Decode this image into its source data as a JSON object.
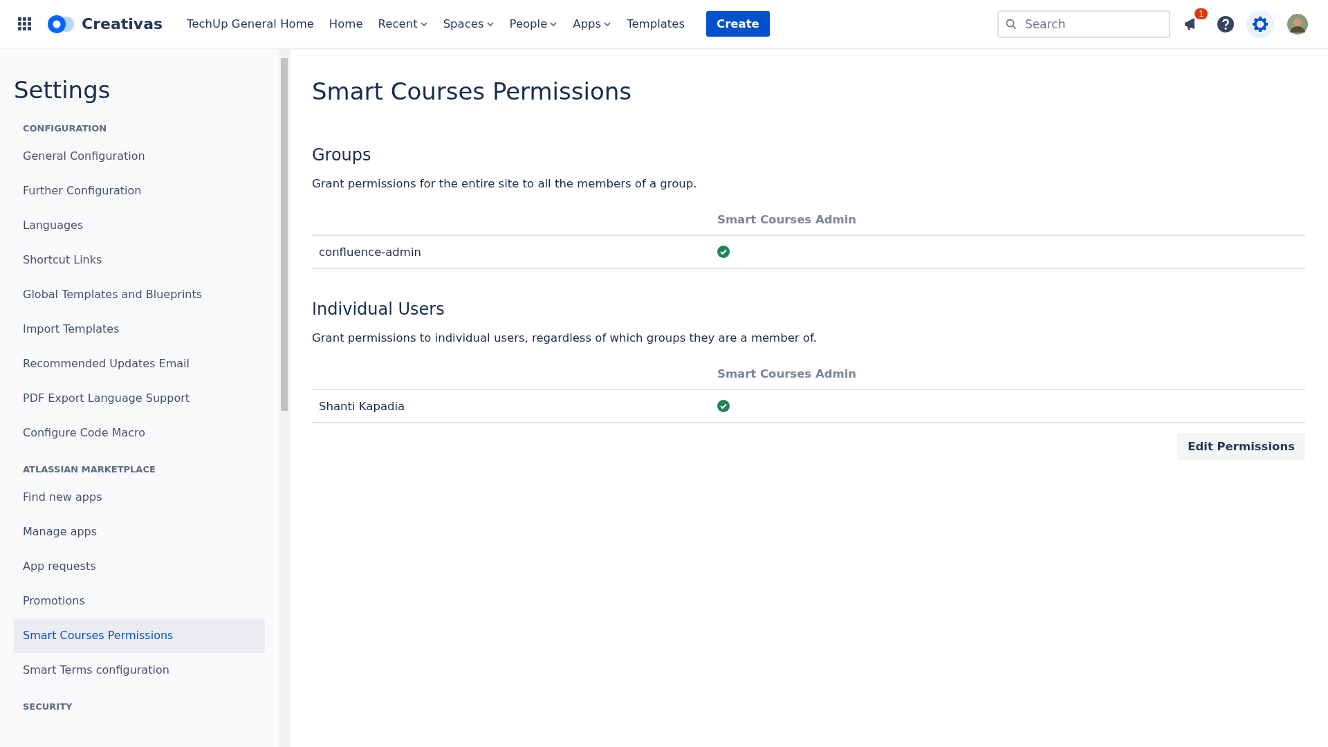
{
  "header": {
    "logo": "Creativas",
    "nav": [
      {
        "label": "TechUp General Home",
        "dropdown": false
      },
      {
        "label": "Home",
        "dropdown": false
      },
      {
        "label": "Recent",
        "dropdown": true
      },
      {
        "label": "Spaces",
        "dropdown": true
      },
      {
        "label": "People",
        "dropdown": true
      },
      {
        "label": "Apps",
        "dropdown": true
      },
      {
        "label": "Templates",
        "dropdown": false
      }
    ],
    "create": "Create",
    "search": {
      "placeholder": "Search"
    },
    "notification_count": "1"
  },
  "sidebar": {
    "title": "Settings",
    "sections": [
      {
        "heading": "CONFIGURATION",
        "items": [
          {
            "label": "General Configuration",
            "selected": false
          },
          {
            "label": "Further Configuration",
            "selected": false
          },
          {
            "label": "Languages",
            "selected": false
          },
          {
            "label": "Shortcut Links",
            "selected": false
          },
          {
            "label": "Global Templates and Blueprints",
            "selected": false
          },
          {
            "label": "Import Templates",
            "selected": false
          },
          {
            "label": "Recommended Updates Email",
            "selected": false
          },
          {
            "label": "PDF Export Language Support",
            "selected": false
          },
          {
            "label": "Configure Code Macro",
            "selected": false
          }
        ]
      },
      {
        "heading": "ATLASSIAN MARKETPLACE",
        "items": [
          {
            "label": "Find new apps",
            "selected": false
          },
          {
            "label": "Manage apps",
            "selected": false
          },
          {
            "label": "App requests",
            "selected": false
          },
          {
            "label": "Promotions",
            "selected": false
          },
          {
            "label": "Smart Courses Permissions",
            "selected": true
          },
          {
            "label": "Smart Terms configuration",
            "selected": false
          }
        ]
      },
      {
        "heading": "SECURITY"
      }
    ]
  },
  "main": {
    "title": "Smart Courses Permissions",
    "sections": [
      {
        "heading": "Groups",
        "description": "Grant permissions for the entire site to all the members of a group.",
        "column": "Smart Courses Admin",
        "rows": [
          {
            "name": "confluence-admin",
            "granted": true
          }
        ]
      },
      {
        "heading": "Individual Users",
        "description": "Grant permissions to individual users, regardless of which groups they are a member of.",
        "column": "Smart Courses Admin",
        "rows": [
          {
            "name": "Shanti Kapadia",
            "granted": true
          }
        ]
      }
    ],
    "edit_button": "Edit Permissions"
  }
}
